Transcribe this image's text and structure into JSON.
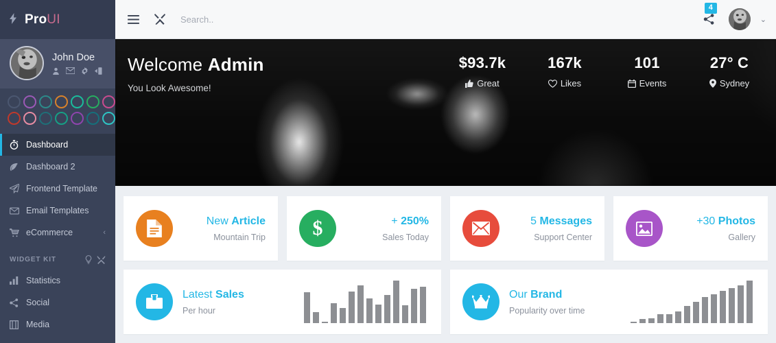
{
  "brand": {
    "bolt_icon": "bolt-icon",
    "name_1": "Pro",
    "name_2": "UI"
  },
  "sidebar": {
    "user": {
      "name": "John Doe",
      "avatar_icon": "user-avatar",
      "actions": [
        {
          "icon": "profile-icon",
          "name": "profile"
        },
        {
          "icon": "envelope-icon",
          "name": "messages"
        },
        {
          "icon": "gear-icon",
          "name": "settings"
        },
        {
          "icon": "logout-icon",
          "name": "logout"
        }
      ]
    },
    "swatches": [
      {
        "color": "#4b5770"
      },
      {
        "color": "#9b59b6"
      },
      {
        "color": "#2c8a8a"
      },
      {
        "color": "#d9822b"
      },
      {
        "color": "#1abc9c"
      },
      {
        "color": "#27ae60"
      },
      {
        "color": "#c94b8f"
      },
      {
        "color": "#c0392b"
      },
      {
        "color": "#e78ca3"
      },
      {
        "color": "#1f6f78"
      },
      {
        "color": "#16a085"
      },
      {
        "color": "#8e44ad"
      },
      {
        "color": "#16707b"
      },
      {
        "color": "#2ec4c4"
      }
    ],
    "nav": [
      {
        "label": "Dashboard",
        "icon": "stopwatch-icon",
        "active": true,
        "caret": ""
      },
      {
        "label": "Dashboard 2",
        "icon": "leaf-icon",
        "active": false,
        "caret": ""
      },
      {
        "label": "Frontend Template",
        "icon": "paper-plane-icon",
        "active": false,
        "caret": ""
      },
      {
        "label": "Email Templates",
        "icon": "envelope-icon",
        "active": false,
        "caret": ""
      },
      {
        "label": "eCommerce",
        "icon": "cart-icon",
        "active": false,
        "caret": "‹"
      }
    ],
    "section_header": {
      "label": "WIDGET KIT",
      "icons": [
        {
          "icon": "lightbulb-icon"
        },
        {
          "icon": "tools-icon"
        }
      ]
    },
    "nav_widgets": [
      {
        "label": "Statistics",
        "icon": "bar-chart-icon",
        "active": false
      },
      {
        "label": "Social",
        "icon": "share-icon",
        "active": false
      },
      {
        "label": "Media",
        "icon": "media-icon",
        "active": false
      }
    ]
  },
  "topbar": {
    "menu_icon": "hamburger-icon",
    "tools_icon": "tools-icon",
    "search_placeholder": "Search..",
    "search_value": "",
    "share_icon": "share-icon",
    "badge_count": "4",
    "avatar_icon": "user-avatar",
    "chevron_icon": "chevron-down-icon",
    "chevron_glyph": "⌄"
  },
  "hero": {
    "title_prefix": "Welcome ",
    "title_strong": "Admin",
    "subtitle": "You Look Awesome!",
    "stats": [
      {
        "value": "$93.7k",
        "label": "Great",
        "icon": "thumbs-up-icon"
      },
      {
        "value": "167k",
        "label": "Likes",
        "icon": "heart-icon"
      },
      {
        "value": "101",
        "label": "Events",
        "icon": "calendar-icon"
      },
      {
        "value": "27° C",
        "label": "Sydney",
        "icon": "map-pin-icon"
      }
    ]
  },
  "cards": [
    {
      "icon": "document-icon",
      "color": "#e8801f",
      "title_1": "New ",
      "title_2": "Article",
      "sub": "Mountain Trip"
    },
    {
      "icon": "dollar-icon",
      "color": "#27ae60",
      "title_1": "+ ",
      "title_2": "250%",
      "sub": "Sales Today"
    },
    {
      "icon": "envelope-icon",
      "color": "#e74c3c",
      "title_1": "5 ",
      "title_2": "Messages",
      "sub": "Support Center"
    },
    {
      "icon": "image-icon",
      "color": "#a855c8",
      "title_1": "+30 ",
      "title_2": "Photos",
      "sub": "Gallery"
    }
  ],
  "wide_cards": [
    {
      "icon": "briefcase-icon",
      "color": "#23b7e5",
      "title_1": "Latest ",
      "title_2": "Sales",
      "sub": "Per hour"
    },
    {
      "icon": "crown-icon",
      "color": "#23b7e5",
      "title_1": "Our ",
      "title_2": "Brand",
      "sub": "Popularity over time"
    }
  ],
  "chart_data": [
    {
      "type": "bar",
      "title": "Latest Sales",
      "subtitle": "Per hour",
      "xlabel": "",
      "ylabel": "",
      "categories": [
        "1",
        "2",
        "3",
        "4",
        "5",
        "6",
        "7",
        "8",
        "9",
        "10",
        "11",
        "12",
        "13",
        "14"
      ],
      "values": [
        72,
        26,
        3,
        46,
        36,
        74,
        88,
        58,
        44,
        66,
        100,
        42,
        80,
        86
      ],
      "ylim": [
        0,
        100
      ],
      "grid": false,
      "legend": "none",
      "bar_color": "#8d8f93"
    },
    {
      "type": "bar",
      "title": "Our Brand",
      "subtitle": "Popularity over time",
      "xlabel": "",
      "ylabel": "",
      "categories": [
        "1",
        "2",
        "3",
        "4",
        "5",
        "6",
        "7",
        "8",
        "9",
        "10",
        "11",
        "12",
        "13",
        "14"
      ],
      "values": [
        3,
        9,
        12,
        21,
        21,
        28,
        40,
        50,
        62,
        68,
        76,
        82,
        88,
        100
      ],
      "ylim": [
        0,
        100
      ],
      "grid": false,
      "legend": "none",
      "bar_color": "#8d8f93"
    }
  ]
}
